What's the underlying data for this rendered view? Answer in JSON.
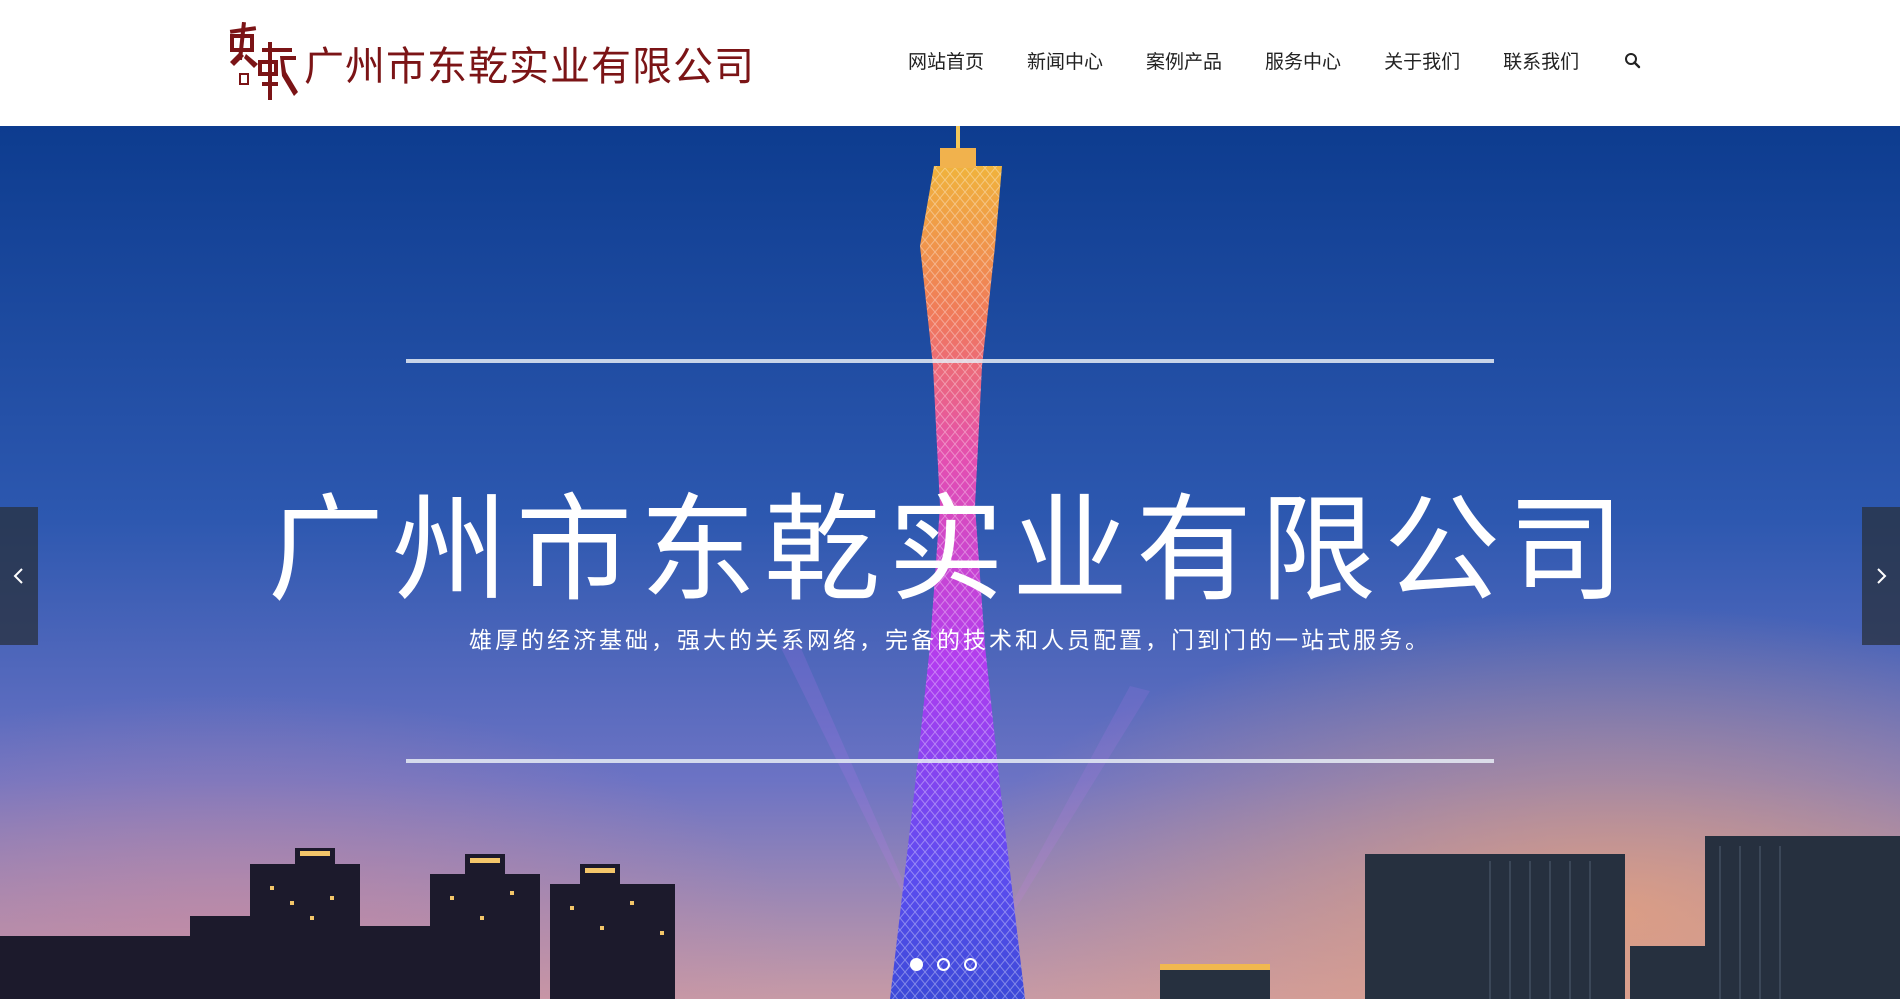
{
  "header": {
    "logo_text": "广州市东乾实业有限公司",
    "nav": [
      "网站首页",
      "新闻中心",
      "案例产品",
      "服务中心",
      "关于我们",
      "联系我们"
    ],
    "search_icon": "search-icon"
  },
  "hero": {
    "title": "广州市东乾实业有限公司",
    "subtitle": "雄厚的经济基础，强大的关系网络，完备的技术和人员配置，门到门的一站式服务。",
    "slides_total": 3,
    "active_slide": 1
  },
  "colors": {
    "brand": "#7b1416",
    "nav_text": "#222222",
    "sky_top": "#0d3c8f",
    "sky_bottom": "#c79aa6"
  }
}
